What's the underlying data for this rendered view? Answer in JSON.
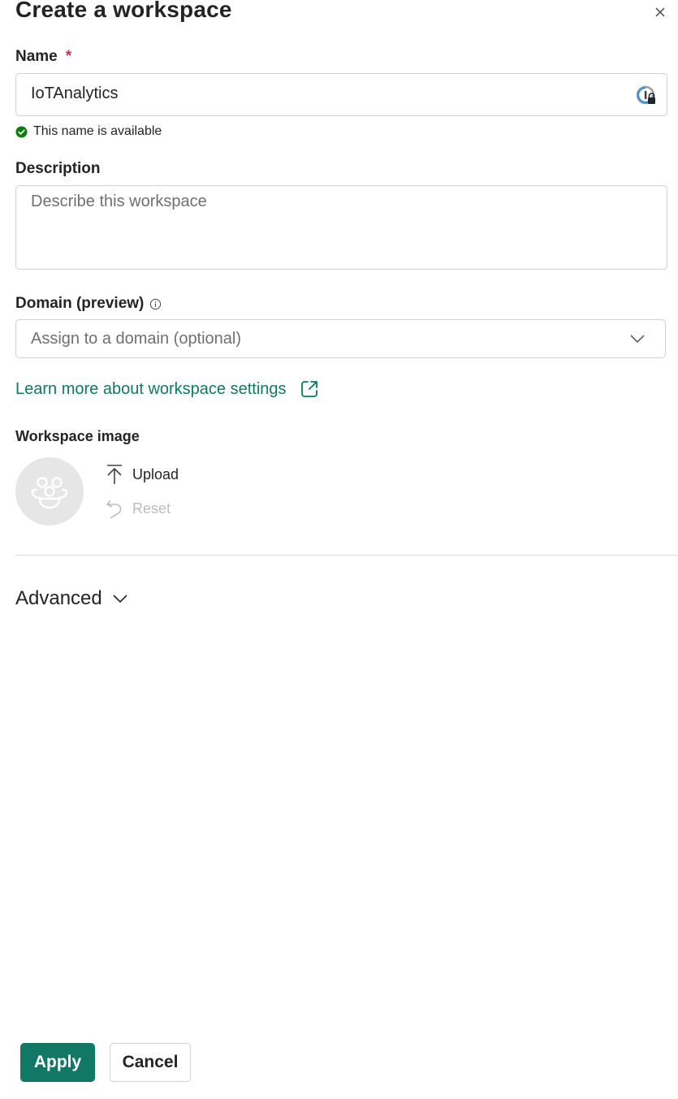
{
  "dialog": {
    "title": "Create a workspace",
    "close_icon": "close-icon"
  },
  "name_field": {
    "label": "Name",
    "required_marker": "*",
    "value": "IoTAnalytics",
    "icon": "password-manager-lock-icon",
    "validation_message": "This name is available",
    "validation_icon": "check-circle-icon",
    "validation_color": "#107c10"
  },
  "description_field": {
    "label": "Description",
    "value": "",
    "placeholder": "Describe this workspace"
  },
  "domain_field": {
    "label": "Domain (preview)",
    "info_icon": "info-icon",
    "placeholder": "Assign to a domain (optional)",
    "chevron_icon": "chevron-down-icon"
  },
  "learn_more_link": {
    "label": "Learn more about workspace settings",
    "icon": "open-external-icon",
    "color": "#117865"
  },
  "workspace_image": {
    "label": "Workspace image",
    "avatar_icon": "group-people-icon",
    "upload_label": "Upload",
    "upload_icon": "upload-arrow-icon",
    "reset_label": "Reset",
    "reset_icon": "undo-icon"
  },
  "advanced": {
    "label": "Advanced",
    "chevron_icon": "chevron-down-icon"
  },
  "footer": {
    "apply_label": "Apply",
    "cancel_label": "Cancel",
    "accent_color": "#117865"
  }
}
